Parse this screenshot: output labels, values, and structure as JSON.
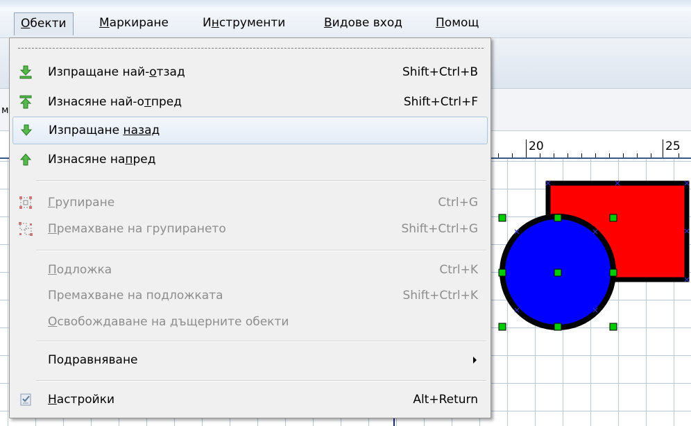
{
  "menubar": {
    "items": [
      {
        "pre": "",
        "u": "О",
        "post": "бекти"
      },
      {
        "pre": "",
        "u": "М",
        "post": "аркиране"
      },
      {
        "pre": "И",
        "u": "н",
        "post": "струменти"
      },
      {
        "pre": "",
        "u": "В",
        "post": "идове вход"
      },
      {
        "pre": "",
        "u": "П",
        "post": "омощ"
      }
    ]
  },
  "ruler": {
    "label_20": "20",
    "label_25": "25"
  },
  "menu": {
    "items": [
      {
        "pre": "Изпращане най-",
        "u": "о",
        "post": "тзад",
        "shortcut": "Shift+Ctrl+B",
        "icon": "send-to-back-icon"
      },
      {
        "pre": "Изнасяне най-о",
        "u": "т",
        "post": "пред",
        "shortcut": "Shift+Ctrl+F",
        "icon": "bring-to-front-icon"
      },
      {
        "pre": "Изпращане ",
        "u": "назад",
        "post": "",
        "shortcut": "",
        "icon": "send-backward-icon"
      },
      {
        "pre": "Изнасяне на",
        "u": "п",
        "post": "ред",
        "shortcut": "",
        "icon": "bring-forward-icon"
      },
      {
        "pre": "",
        "u": "Г",
        "post": "рупиране",
        "shortcut": "Ctrl+G",
        "icon": "group-icon"
      },
      {
        "pre": "",
        "u": "П",
        "post": "ремахване на групирането",
        "shortcut": "Shift+Ctrl+G",
        "icon": "ungroup-icon"
      },
      {
        "pre": "",
        "u": "П",
        "post": "одложка",
        "shortcut": "Ctrl+K",
        "icon": ""
      },
      {
        "pre": "Премахване на подложката",
        "u": "",
        "post": "",
        "shortcut": "Shift+Ctrl+K",
        "icon": ""
      },
      {
        "pre": "",
        "u": "О",
        "post": "свобождаване на дъщерните обекти",
        "shortcut": "",
        "icon": ""
      },
      {
        "pre": "Подравняване",
        "u": "",
        "post": "",
        "shortcut": "",
        "icon": ""
      },
      {
        "pre": "",
        "u": "Н",
        "post": "астройки",
        "shortcut": "Alt+Return",
        "icon": "properties-icon"
      }
    ]
  },
  "toolbar_fragment": "м",
  "colors": {
    "rectangle": "#ff0000",
    "circle": "#0000ff",
    "handle": "#00cc00",
    "highlight": "#e3ecf7"
  }
}
